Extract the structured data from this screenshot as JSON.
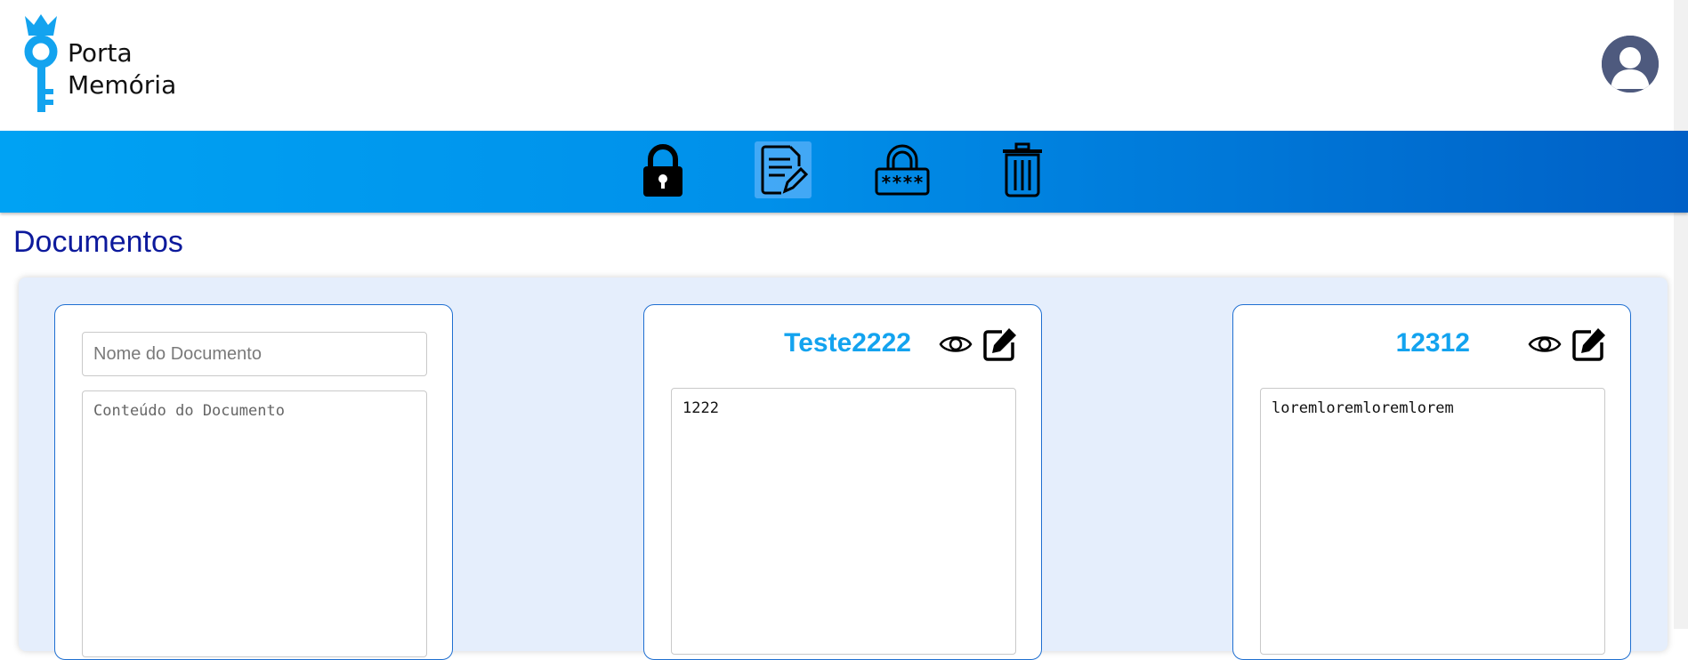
{
  "brand": {
    "line1": "Porta",
    "line2": "Memória"
  },
  "colors": {
    "accent": "#13a3ef",
    "title": "#0d1a9c",
    "nav_start": "#00a2f3",
    "nav_end": "#0060c6",
    "panel": "#e5eefc"
  },
  "nav": {
    "items": [
      {
        "name": "lock",
        "icon": "padlock-icon",
        "active": false
      },
      {
        "name": "documents",
        "icon": "document-edit-icon",
        "active": true
      },
      {
        "name": "passwords",
        "icon": "password-lock-icon",
        "active": false
      },
      {
        "name": "trash",
        "icon": "trash-icon",
        "active": false
      }
    ]
  },
  "page": {
    "title": "Documentos"
  },
  "new_document": {
    "name_placeholder": "Nome do Documento",
    "content_placeholder": "Conteúdo do Documento"
  },
  "documents": [
    {
      "title": "Teste2222",
      "content": "1222"
    },
    {
      "title": "12312",
      "content": "loremloremloremlorem"
    }
  ]
}
